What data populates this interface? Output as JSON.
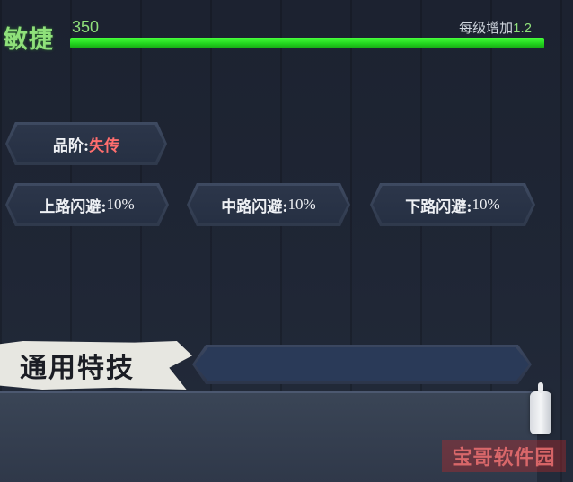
{
  "stat": {
    "name": "敏捷",
    "value": "350",
    "growth_label": "每级增加",
    "growth_value": "1.2",
    "bar_fraction": 1.0
  },
  "grade": {
    "label": "品阶:",
    "value": "失传"
  },
  "dodges": [
    {
      "label": "上路闪避:",
      "value": "10%"
    },
    {
      "label": "中路闪避:",
      "value": "10%"
    },
    {
      "label": "下路闪避:",
      "value": "10%"
    }
  ],
  "section": {
    "title": "通用特技"
  },
  "watermark": "宝哥软件园",
  "colors": {
    "accent_green": "#8fe07a",
    "bar_green": "#22d41e",
    "grade_red": "#ff6e6e"
  }
}
